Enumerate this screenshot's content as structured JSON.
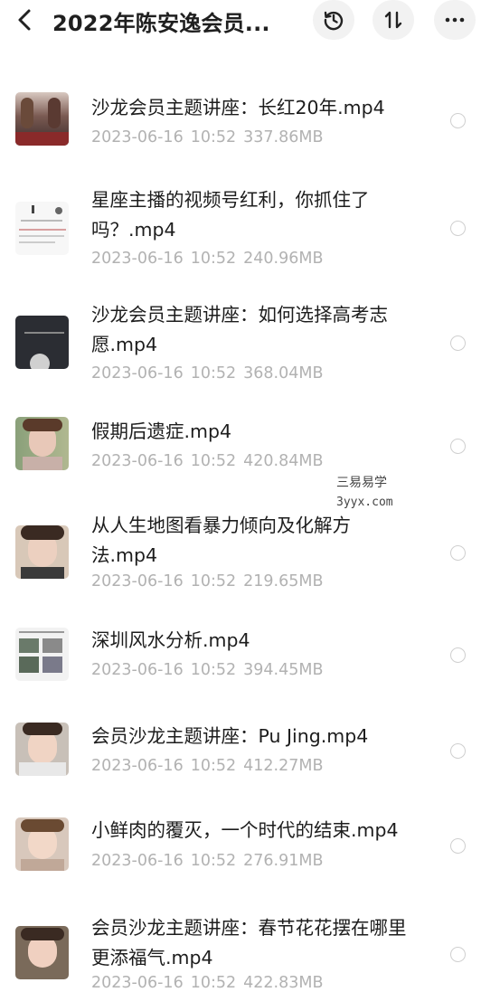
{
  "header": {
    "title": "2022年陈安逸会员...",
    "back_icon": "back-arrow-icon",
    "history_icon": "history-icon",
    "sort_icon": "sort-icon",
    "more_icon": "more-icon"
  },
  "files": [
    {
      "name": "沙龙会员主题讲座：长红20年.mp4",
      "date": "2023-06-16",
      "time": "10:52",
      "size": "337.86MB"
    },
    {
      "name": "星座主播的视频号红利，你抓住了吗？.mp4",
      "date": "2023-06-16",
      "time": "10:52",
      "size": "240.96MB"
    },
    {
      "name": "沙龙会员主题讲座：如何选择高考志愿.mp4",
      "date": "2023-06-16",
      "time": "10:52",
      "size": "368.04MB"
    },
    {
      "name": "假期后遗症.mp4",
      "date": "2023-06-16",
      "time": "10:52",
      "size": "420.84MB"
    },
    {
      "name": "从人生地图看暴力倾向及化解方法.mp4",
      "date": "2023-06-16",
      "time": "10:52",
      "size": "219.65MB"
    },
    {
      "name": "深圳风水分析.mp4",
      "date": "2023-06-16",
      "time": "10:52",
      "size": "394.45MB"
    },
    {
      "name": "会员沙龙主题讲座：Pu Jing.mp4",
      "date": "2023-06-16",
      "time": "10:52",
      "size": "412.27MB"
    },
    {
      "name": "小鲜肉的覆灭，一个时代的结束.mp4",
      "date": "2023-06-16",
      "time": "10:52",
      "size": "276.91MB"
    },
    {
      "name": "会员沙龙主题讲座：春节花花摆在哪里更添福气.mp4",
      "date": "2023-06-16",
      "time": "10:52",
      "size": "422.83MB"
    }
  ],
  "watermark": {
    "line1": "三易易学",
    "line2": "3yyx.com"
  }
}
